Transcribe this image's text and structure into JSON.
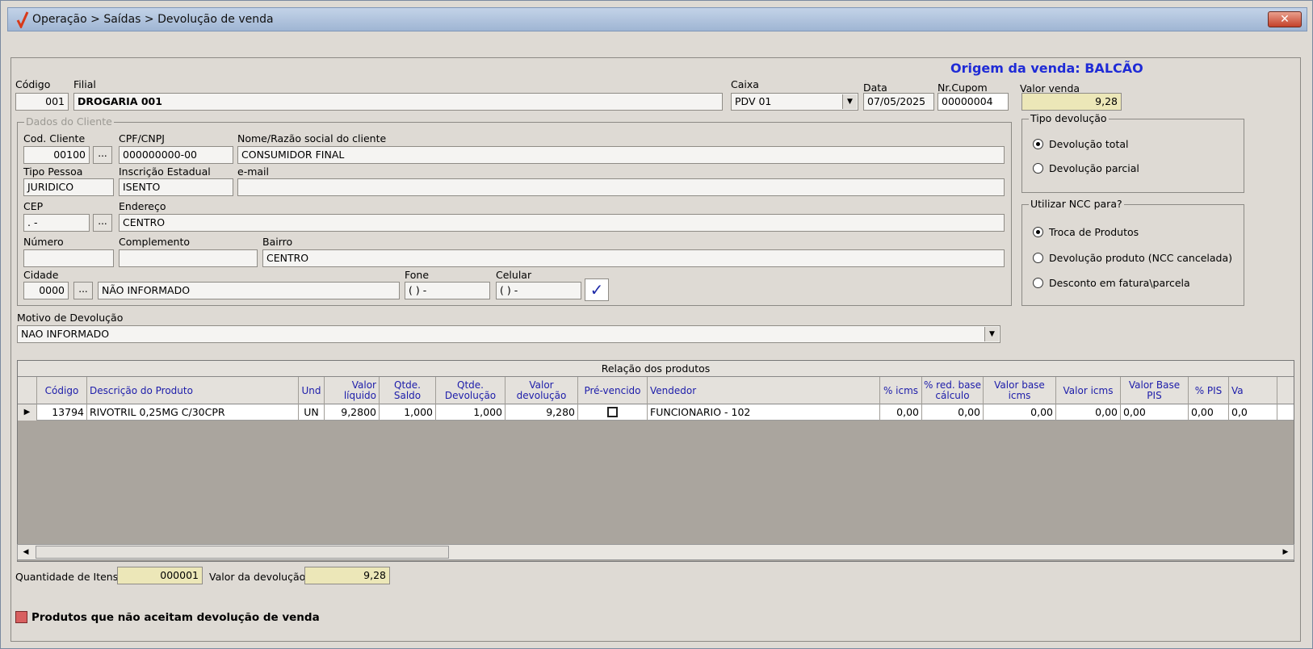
{
  "window": {
    "title": "Operação > Saídas > Devolução de venda",
    "close": "✕"
  },
  "origem": "Origem da venda: BALCÃO",
  "header": {
    "codigo_label": "Código",
    "codigo": "001",
    "filial_label": "Filial",
    "filial": "DROGARIA 001",
    "caixa_label": "Caixa",
    "caixa": "PDV 01",
    "data_label": "Data",
    "data": "07/05/2025",
    "cupom_label": "Nr.Cupom",
    "cupom": "00000004",
    "valor_label": "Valor venda",
    "valor": "9,28"
  },
  "cliente": {
    "group": "Dados do Cliente",
    "cod_label": "Cod. Cliente",
    "cod": "00100",
    "cpf_label": "CPF/CNPJ",
    "cpf": "000000000-00",
    "nome_label": "Nome/Razão social do cliente",
    "nome": "CONSUMIDOR FINAL",
    "tipo_label": "Tipo Pessoa",
    "tipo": "JURIDICO",
    "ie_label": "Inscrição Estadual",
    "ie": "ISENTO",
    "email_label": "e-mail",
    "email": "",
    "cep_label": "CEP",
    "cep": " .  -",
    "endereco_label": "Endereço",
    "endereco": "CENTRO",
    "numero_label": "Número",
    "numero": "",
    "complemento_label": "Complemento",
    "complemento": "",
    "bairro_label": "Bairro",
    "bairro": "CENTRO",
    "cidade_label": "Cidade",
    "cidade_cod": "0000",
    "cidade": "NÃO INFORMADO",
    "fone_label": "Fone",
    "fone": "(  )     -",
    "celular_label": "Celular",
    "celular": "(  )     -",
    "lookup": "...",
    "confirm": "✓"
  },
  "tipo_devolucao": {
    "group": "Tipo devolução",
    "options": [
      "Devolução total",
      "Devolução parcial"
    ],
    "selected": 0
  },
  "ncc": {
    "group": "Utilizar NCC para?",
    "options": [
      "Troca de Produtos",
      "Devolução produto (NCC cancelada)",
      "Desconto em fatura\\parcela"
    ],
    "selected": 0
  },
  "motivo": {
    "label": "Motivo de Devolução",
    "value": "NAO INFORMADO"
  },
  "grid": {
    "caption": "Relação dos produtos",
    "columns": [
      "Código",
      "Descrição do Produto",
      "Und",
      "Valor líquido",
      "Qtde. Saldo",
      "Qtde. Devolução",
      "Valor devolução",
      "Pré-vencido",
      "Vendedor",
      "% icms",
      "% red. base cálculo",
      "Valor base icms",
      "Valor icms",
      "Valor Base PIS",
      "% PIS",
      "Va"
    ],
    "row": [
      "13794",
      "RIVOTRIL 0,25MG C/30CPR",
      "UN",
      "9,2800",
      "1,000",
      "1,000",
      "9,280",
      "",
      "FUNCIONARIO - 102",
      "0,00",
      "0,00",
      "0,00",
      "0,00",
      "0,00",
      "0,00",
      "0,0"
    ]
  },
  "footer": {
    "qtd_label": "Quantidade de Itens:",
    "qtd": "000001",
    "valor_label": "Valor da devolução:",
    "valor": "9,28",
    "legend": "Produtos que não aceitam devolução de venda"
  }
}
